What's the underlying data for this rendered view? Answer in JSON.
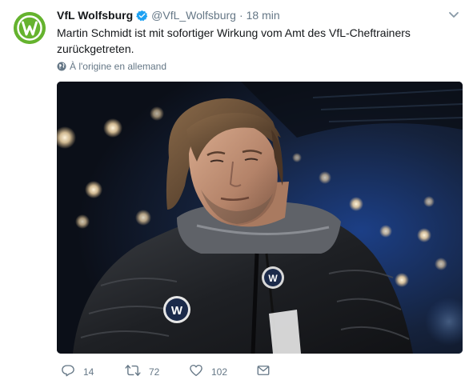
{
  "tweet": {
    "author_name": "VfL Wolfsburg",
    "author_handle": "@VfL_Wolfsburg",
    "separator": "·",
    "time": "18 min",
    "text": "Martin Schmidt ist mit sofortiger Wirkung vom Amt des VfL-Cheftrainers zurückgetreten.",
    "translate_label": "À l'origine en allemand",
    "reply_count": "14",
    "retweet_count": "72",
    "like_count": "102"
  },
  "colors": {
    "brand_green": "#65b32e",
    "verified_blue": "#1da1f2",
    "muted": "#657786"
  },
  "icons": {
    "verified": "verified-badge-icon",
    "caret": "chevron-down-icon",
    "globe": "globe-icon",
    "reply": "reply-icon",
    "retweet": "retweet-icon",
    "like": "heart-icon",
    "message": "envelope-icon"
  }
}
